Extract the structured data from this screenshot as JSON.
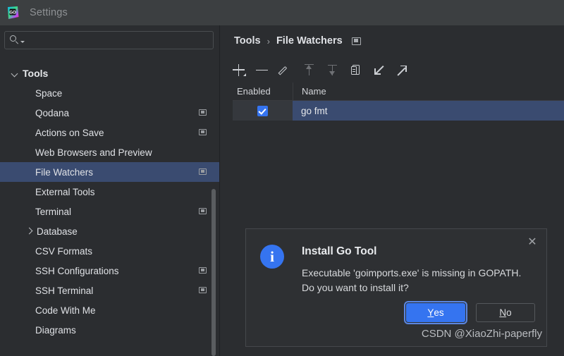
{
  "window": {
    "title": "Settings",
    "logo_icon": "goland-logo-icon"
  },
  "sidebar": {
    "search": {
      "value": "",
      "placeholder": "",
      "icon": "search-icon"
    },
    "group": {
      "label": "Tools",
      "expanded": true
    },
    "items": [
      {
        "label": "Space",
        "badge": false,
        "expandable": false,
        "selected": false
      },
      {
        "label": "Qodana",
        "badge": true,
        "expandable": false,
        "selected": false
      },
      {
        "label": "Actions on Save",
        "badge": true,
        "expandable": false,
        "selected": false
      },
      {
        "label": "Web Browsers and Preview",
        "badge": false,
        "expandable": false,
        "selected": false
      },
      {
        "label": "File Watchers",
        "badge": true,
        "expandable": false,
        "selected": true
      },
      {
        "label": "External Tools",
        "badge": false,
        "expandable": false,
        "selected": false
      },
      {
        "label": "Terminal",
        "badge": true,
        "expandable": false,
        "selected": false
      },
      {
        "label": "Database",
        "badge": false,
        "expandable": true,
        "selected": false
      },
      {
        "label": "CSV Formats",
        "badge": false,
        "expandable": false,
        "selected": false
      },
      {
        "label": "SSH Configurations",
        "badge": true,
        "expandable": false,
        "selected": false
      },
      {
        "label": "SSH Terminal",
        "badge": true,
        "expandable": false,
        "selected": false
      },
      {
        "label": "Code With Me",
        "badge": false,
        "expandable": false,
        "selected": false
      },
      {
        "label": "Diagrams",
        "badge": false,
        "expandable": false,
        "selected": false
      }
    ]
  },
  "main": {
    "breadcrumb": {
      "root": "Tools",
      "separator": "›",
      "current": "File Watchers",
      "badge_icon": "project-scope-icon"
    },
    "toolbar": [
      {
        "name": "add-button",
        "icon": "plus-icon",
        "enabled": true
      },
      {
        "name": "remove-button",
        "icon": "minus-icon",
        "enabled": true
      },
      {
        "name": "edit-button",
        "icon": "pencil-icon",
        "enabled": true
      },
      {
        "name": "move-up-button",
        "icon": "arrow-up-icon",
        "enabled": false
      },
      {
        "name": "move-down-button",
        "icon": "arrow-down-icon",
        "enabled": false
      },
      {
        "name": "copy-button",
        "icon": "copy-icon",
        "enabled": true
      },
      {
        "name": "import-button",
        "icon": "import-arrow-icon",
        "enabled": true
      },
      {
        "name": "export-button",
        "icon": "export-arrow-icon",
        "enabled": true
      }
    ],
    "table": {
      "columns": [
        "Enabled",
        "Name"
      ],
      "rows": [
        {
          "enabled": true,
          "name": "go fmt",
          "selected": true
        }
      ]
    }
  },
  "dialog": {
    "icon": "info-icon",
    "icon_glyph": "i",
    "title": "Install Go Tool",
    "message": "Executable 'goimports.exe' is missing in GOPATH. Do you want to install it?",
    "close_icon": "close-icon",
    "close_glyph": "✕",
    "buttons": [
      {
        "name": "yes-button",
        "label_prefix": "",
        "mnemonic": "Y",
        "label_suffix": "es",
        "default": true
      },
      {
        "name": "no-button",
        "label_prefix": "",
        "mnemonic": "N",
        "label_suffix": "o",
        "default": false
      }
    ]
  },
  "watermark": {
    "text": "CSDN @XiaoZhi-paperfly"
  },
  "colors": {
    "window_bg": "#2b2d30",
    "titlebar_bg": "#3c3f41",
    "selection_blue": "#3a4b70",
    "accent_blue": "#3574f0",
    "dialog_bg": "#2e3033",
    "text_primary": "#dfe1e5",
    "text_muted": "#8f9295"
  }
}
